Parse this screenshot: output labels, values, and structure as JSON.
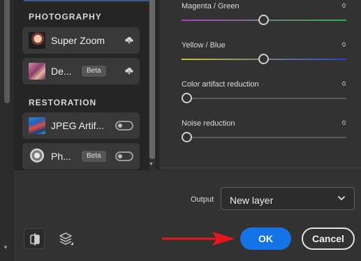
{
  "filters": {
    "sections": [
      {
        "title": "PHOTOGRAPHY",
        "items": [
          {
            "label": "Super Zoom",
            "beta": "",
            "control": "cloud-download-icon"
          },
          {
            "label": "De...",
            "beta": "Beta",
            "control": "cloud-download-icon"
          }
        ]
      },
      {
        "title": "RESTORATION",
        "items": [
          {
            "label": "JPEG Artif...",
            "beta": "",
            "control": "toggle-off"
          },
          {
            "label": "Ph...",
            "beta": "Beta",
            "control": "toggle-off"
          }
        ]
      }
    ]
  },
  "settings": {
    "sliders": [
      {
        "label": "Magenta / Green",
        "value": "0",
        "gradient": [
          "#b13ec6",
          "#2fb34a"
        ],
        "position": 0.5
      },
      {
        "label": "Yellow / Blue",
        "value": "0",
        "gradient": [
          "#c9c22e",
          "#2b3fcf"
        ],
        "position": 0.5
      },
      {
        "label": "Color artifact reduction",
        "value": "0",
        "gradient": [
          "#5a5a5a",
          "#5a5a5a"
        ],
        "position": 0.0
      },
      {
        "label": "Noise reduction",
        "value": "0",
        "gradient": [
          "#5a5a5a",
          "#5a5a5a"
        ],
        "position": 0.0
      }
    ]
  },
  "output": {
    "label": "Output",
    "selected": "New layer"
  },
  "buttons": {
    "ok": "OK",
    "cancel": "Cancel"
  },
  "colors": {
    "accent": "#1473e6",
    "arrow": "#e8161b"
  }
}
